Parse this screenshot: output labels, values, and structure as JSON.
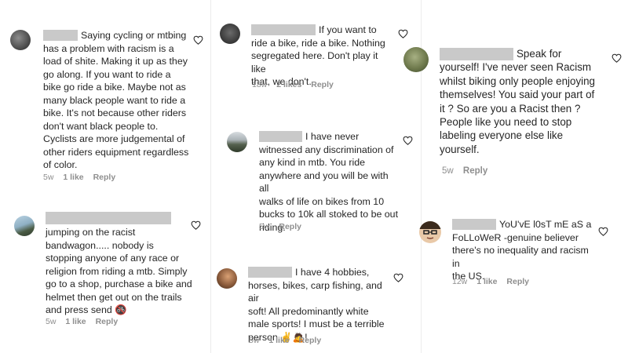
{
  "comments": [
    {
      "text": "Saying cycling or mtbing\nhas a problem with racism is a\nload of shite. Making it up as they\ngo along. If you want to ride a\nbike go ride a bike. Maybe not as\nmany black people want to ride a\nbike. It's not because other riders\ndon't want black people to.\nCyclists are more judgemental of\nother riders equipment regardless\nof color.",
      "time": "5w",
      "likes": "1 like",
      "reply": "Reply"
    },
    {
      "text": "jumping on the racist\nbandwagon..... nobody is\nstopping anyone of any race or\nreligion from riding a mtb. Simply\ngo to a shop, purchase a bike and\nhelmet then get out on the trails\nand press send 🚳",
      "time": "5w",
      "likes": "1 like",
      "reply": "Reply"
    },
    {
      "text": "If you want to\nride a bike, ride a bike. Nothing\nsegregated here. Don't play it like\nthat, we don't.",
      "time": "18w",
      "likes": "2 likes",
      "reply": "Reply"
    },
    {
      "text": "I have never\nwitnessed any discrimination of\nany kind in mtb. You ride\nanywhere and you will be with all\nwalks of life on bikes from 10\nbucks to 10k all stoked to be out\nriding.",
      "time": "5w",
      "likes": "",
      "reply": "Reply"
    },
    {
      "text": "I have 4 hobbies,\nhorses, bikes, carp fishing, and air\nsoft! All predominantly white\nmale sports! I must be a terrible\nperson ✌️🙇!",
      "time": "5w",
      "likes": "1 like",
      "reply": "Reply"
    },
    {
      "text": "Speak for\nyourself! I've never seen Racism\nwhilst biking only people enjoying\nthemselves! You said your part of\nit ? So are you a Racist then ?\nPeople like you need to stop\nlabeling everyone else like\nyourself.",
      "time": "5w",
      "likes": "",
      "reply": "Reply"
    },
    {
      "text": "YoU'vE l0sT mE aS a\nFoLLoWeR -genuine believer\nthere's no inequality and racism in\nthe US.",
      "time": "12w",
      "likes": "1 like",
      "reply": "Reply"
    }
  ],
  "colors": {
    "text": "#262626",
    "meta": "#8e8e8e",
    "redaction": "#c9c9c9",
    "divider": "#ececec"
  },
  "icons": {
    "like": "heart-outline-icon",
    "avatar": "user-avatar"
  }
}
